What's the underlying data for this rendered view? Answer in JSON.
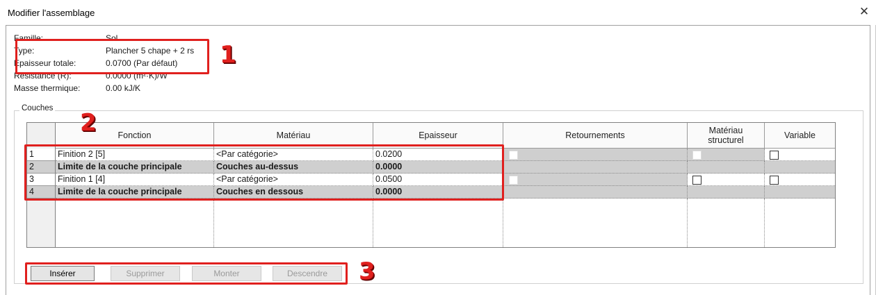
{
  "window": {
    "title": "Modifier l'assemblage",
    "close_icon": "close-icon",
    "close_glyph": "✕"
  },
  "properties": [
    {
      "key": "Famille:",
      "value": "Sol"
    },
    {
      "key": "Type:",
      "value": "Plancher 5 chape + 2 rs"
    },
    {
      "key": "Epaisseur totale:",
      "value": "0.0700 (Par défaut)"
    },
    {
      "key": "Résistance (R):",
      "value": "0.0000 (m²·K)/W"
    },
    {
      "key": "Masse thermique:",
      "value": "0.00 kJ/K"
    }
  ],
  "layers": {
    "group_label": "Couches",
    "columns": [
      "Fonction",
      "Matériau",
      "Epaisseur",
      "Retournements",
      "Matériau structurel",
      "Variable"
    ],
    "rows": [
      {
        "num": "1",
        "fonction": "Finition 2 [5]",
        "materiau": "<Par catégorie>",
        "epaisseur": "0.0200"
      },
      {
        "num": "2",
        "fonction": "Limite de la couche principale",
        "materiau": "Couches au-dessus",
        "epaisseur": "0.0000"
      },
      {
        "num": "3",
        "fonction": "Finition 1 [4]",
        "materiau": "<Par catégorie>",
        "epaisseur": "0.0500"
      },
      {
        "num": "4",
        "fonction": "Limite de la couche principale",
        "materiau": "Couches en dessous",
        "epaisseur": "0.0000"
      }
    ]
  },
  "buttons": {
    "insert": "Insérer",
    "delete": "Supprimer",
    "up": "Monter",
    "down": "Descendre"
  },
  "annotations": {
    "color": "#e0201e",
    "labels": [
      "1",
      "2",
      "3"
    ]
  }
}
